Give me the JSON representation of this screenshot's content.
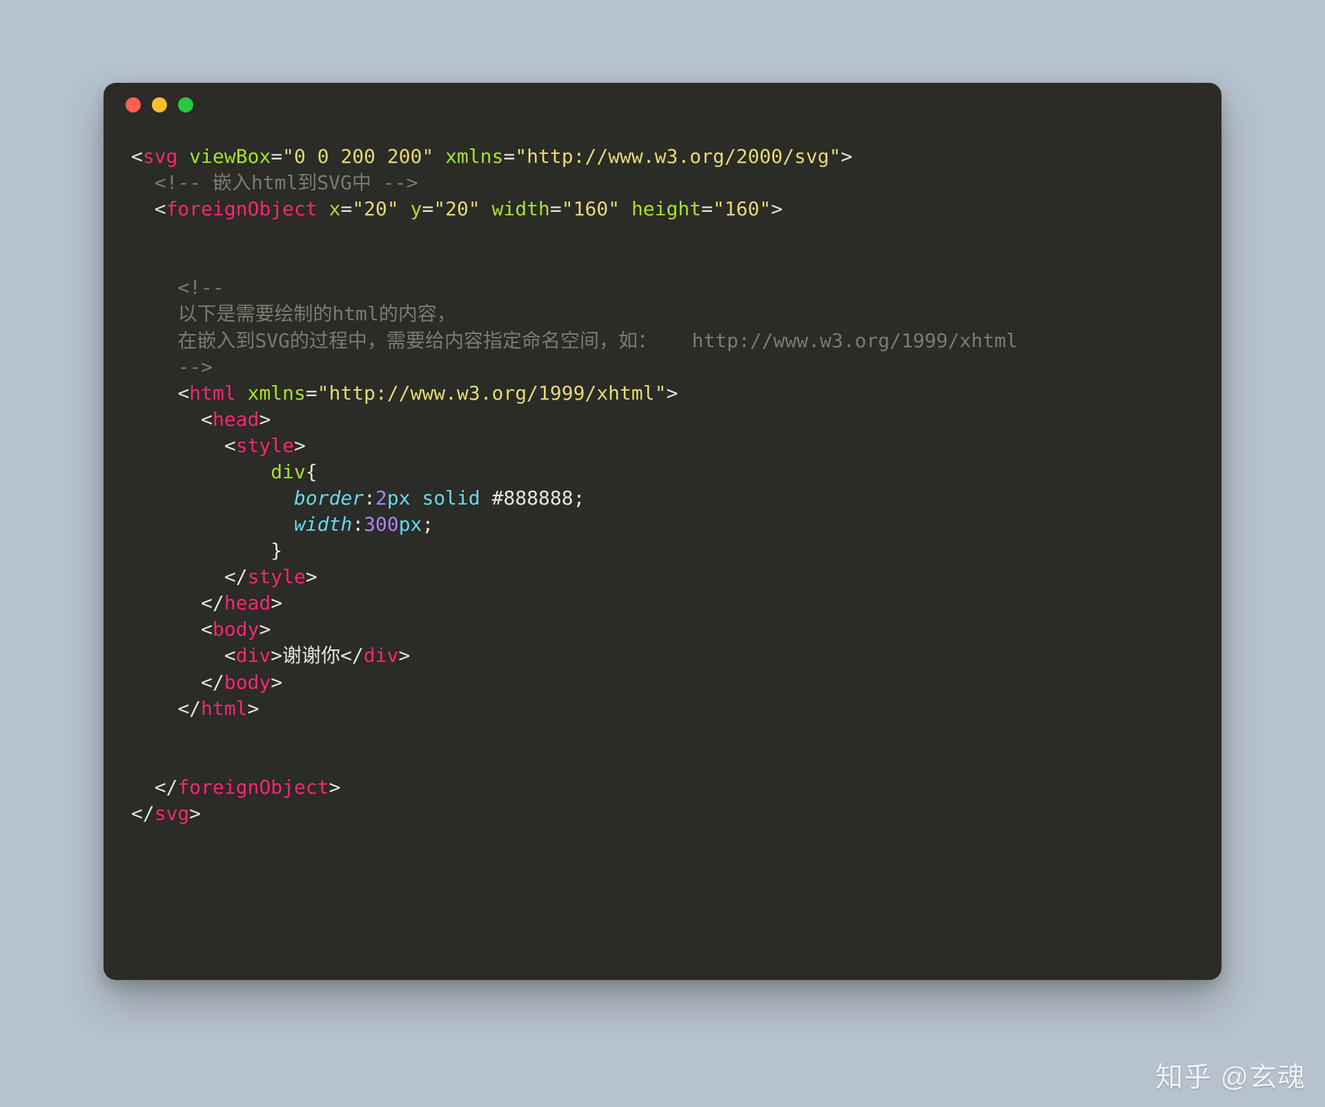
{
  "code": {
    "line1": {
      "p1": "<",
      "tag": "svg",
      "sp": " ",
      "a1": "viewBox",
      "eq": "=",
      "v1": "\"0 0 200 200\"",
      "a2": "xmlns",
      "v2": "\"http://www.w3.org/2000/svg\"",
      "p2": ">"
    },
    "line2": {
      "indent": "  ",
      "text": "<!-- 嵌入html到SVG中 -->"
    },
    "line3": {
      "indent": "  ",
      "p1": "<",
      "tag": "foreignObject",
      "a1": "x",
      "v1": "\"20\"",
      "a2": "y",
      "v2": "\"20\"",
      "a3": "width",
      "v3": "\"160\"",
      "a4": "height",
      "v4": "\"160\"",
      "p2": ">"
    },
    "line4": {
      "indent": "    ",
      "c1": "<!--"
    },
    "line5": {
      "indent": "    ",
      "c2": "以下是需要绘制的html的内容，"
    },
    "line6": {
      "indent": "    ",
      "c3": "在嵌入到SVG的过程中，需要给内容指定命名空间，如：   http://www.w3.org/1999/xhtml"
    },
    "line7": {
      "indent": "    ",
      "c4": "-->"
    },
    "line8": {
      "indent": "    ",
      "p1": "<",
      "tag": "html",
      "a1": "xmlns",
      "v1": "\"http://www.w3.org/1999/xhtml\"",
      "p2": ">"
    },
    "line9": {
      "indent": "      ",
      "p1": "<",
      "tag": "head",
      "p2": ">"
    },
    "line10": {
      "indent": "        ",
      "p1": "<",
      "tag": "style",
      "p2": ">"
    },
    "line11": {
      "indent": "            ",
      "sel": "div",
      "brace": "{"
    },
    "line12": {
      "indent": "              ",
      "prop": "border",
      "colon": ":",
      "num": "2",
      "unit": "px",
      "sp": " ",
      "kw": "solid",
      "sp2": " ",
      "hex": "#888888",
      "semi": ";"
    },
    "line13": {
      "indent": "              ",
      "prop": "width",
      "colon": ":",
      "num": "300",
      "unit": "px",
      "semi": ";"
    },
    "line14": {
      "indent": "            ",
      "brace": "}"
    },
    "line15": {
      "indent": "        ",
      "p1": "</",
      "tag": "style",
      "p2": ">"
    },
    "line16": {
      "indent": "      ",
      "p1": "</",
      "tag": "head",
      "p2": ">"
    },
    "line17": {
      "indent": "      ",
      "p1": "<",
      "tag": "body",
      "p2": ">"
    },
    "line18": {
      "indent": "        ",
      "p1": "<",
      "tag": "div",
      "p2": ">",
      "text": "谢谢你",
      "p3": "</",
      "tag2": "div",
      "p4": ">"
    },
    "line19": {
      "indent": "      ",
      "p1": "</",
      "tag": "body",
      "p2": ">"
    },
    "line20": {
      "indent": "    ",
      "p1": "</",
      "tag": "html",
      "p2": ">"
    },
    "line21": {
      "indent": "  ",
      "p1": "</",
      "tag": "foreignObject",
      "p2": ">"
    },
    "line22": {
      "p1": "</",
      "tag": "svg",
      "p2": ">"
    }
  },
  "watermark": "知乎 @玄魂"
}
